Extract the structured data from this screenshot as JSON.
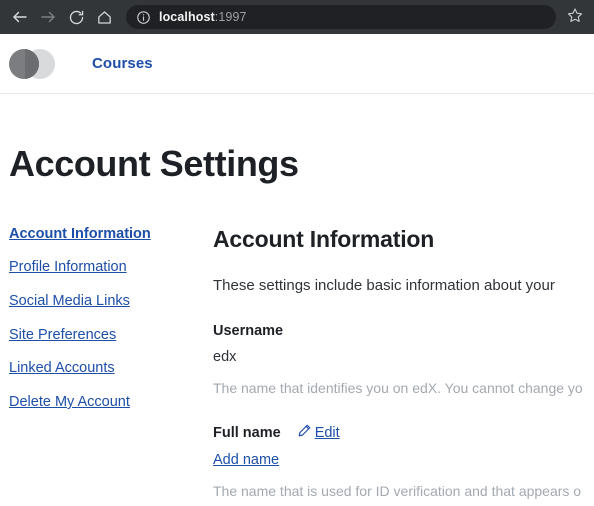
{
  "browser": {
    "back_icon": "back-arrow-icon",
    "forward_icon": "forward-arrow-icon",
    "reload_icon": "reload-icon",
    "home_icon": "home-icon",
    "site_info_icon": "info-circle-icon",
    "bookmark_icon": "star-outline-icon",
    "url_host": "localhost",
    "url_port": ":1997",
    "chrome_bg": "#323639",
    "omnibox_bg": "#202124"
  },
  "site_header": {
    "logo_name": "edx-logo",
    "nav": {
      "courses_label": "Courses"
    }
  },
  "page": {
    "title": "Account Settings",
    "accent_blue": "#1d4ea8",
    "heading_color": "#1d2126"
  },
  "sidebar": {
    "items": [
      {
        "label": "Account Information",
        "active": true
      },
      {
        "label": "Profile Information",
        "active": false
      },
      {
        "label": "Social Media Links",
        "active": false
      },
      {
        "label": "Site Preferences",
        "active": false
      },
      {
        "label": "Linked Accounts",
        "active": false
      },
      {
        "label": "Delete My Account",
        "active": false
      }
    ]
  },
  "main": {
    "section_title": "Account Information",
    "section_description": "These settings include basic information about your",
    "fields": [
      {
        "label": "Username",
        "value": "edx",
        "help": "The name that identifies you on edX. You cannot change yo",
        "edit_label": null,
        "edit_icon": null
      },
      {
        "label": "Full name",
        "value": "Add name",
        "help": "The name that is used for ID verification and that appears o",
        "edit_label": "Edit",
        "edit_icon": "pencil-icon"
      }
    ]
  }
}
